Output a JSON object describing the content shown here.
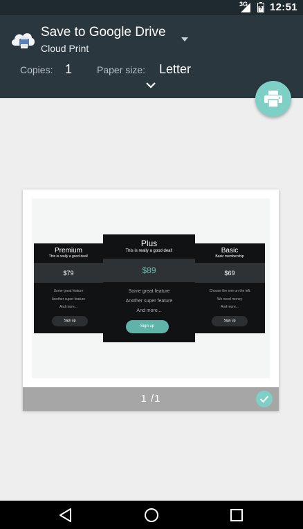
{
  "status_bar": {
    "network": "3G",
    "time": "12:51"
  },
  "header": {
    "printer_name": "Save to Google Drive",
    "printer_sub": "Cloud Print",
    "copies_label": "Copies:",
    "copies_value": "1",
    "paper_label": "Paper size:",
    "paper_value": "Letter"
  },
  "preview": {
    "page_count": "1 /1",
    "plans": [
      {
        "name": "Premium",
        "tagline": "This is really a good deal!",
        "price": "$79",
        "features": [
          "Some great feature",
          "Another super feature",
          "And more..."
        ],
        "button": "Sign up"
      },
      {
        "name": "Plus",
        "tagline": "This is really a good deal!",
        "price": "$89",
        "features": [
          "Some great feature",
          "Another super feature",
          "And more..."
        ],
        "button": "Sign up"
      },
      {
        "name": "Basic",
        "tagline": "Basic membership",
        "price": "$69",
        "features": [
          "Choose the one on the left",
          "We need money",
          "And more..."
        ],
        "button": "Sign up"
      }
    ]
  },
  "colors": {
    "header_bg": "#2b373e",
    "accent": "#7ecfc6",
    "plan_bg": "#101214",
    "plus_price": "#6bbdb3"
  },
  "icons": {
    "printer_icon": "cloud-print-icon",
    "fab": "print-icon",
    "check": "check-icon",
    "nav": [
      "back-icon",
      "home-icon",
      "recents-icon"
    ]
  }
}
